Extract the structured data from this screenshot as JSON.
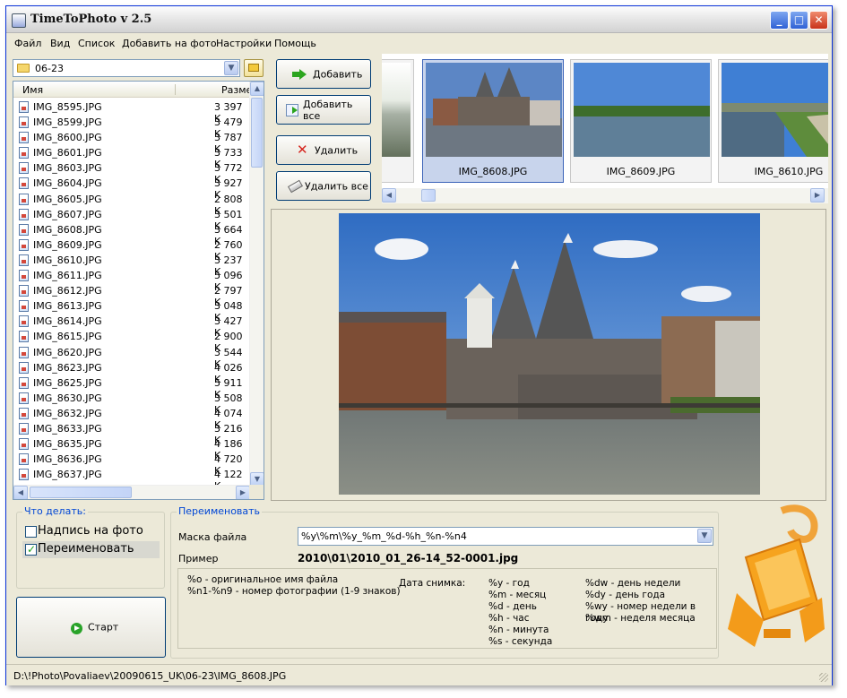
{
  "window": {
    "title": "TimeToPhoto v 2.5"
  },
  "menu": [
    "Файл",
    "Вид",
    "Список",
    "Добавить на фото",
    "Настройки",
    "Помощь"
  ],
  "folder": {
    "current": "06-23"
  },
  "file_list": {
    "columns": [
      "Имя",
      "Разме"
    ],
    "rows": [
      [
        "IMG_8595.JPG",
        "3 397 K"
      ],
      [
        "IMG_8599.JPG",
        "3 479 K"
      ],
      [
        "IMG_8600.JPG",
        "3 787 K"
      ],
      [
        "IMG_8601.JPG",
        "3 733 K"
      ],
      [
        "IMG_8603.JPG",
        "3 772 K"
      ],
      [
        "IMG_8604.JPG",
        "3 927 K"
      ],
      [
        "IMG_8605.JPG",
        "2 808 K"
      ],
      [
        "IMG_8607.JPG",
        "3 501 K"
      ],
      [
        "IMG_8608.JPG",
        "3 664 K"
      ],
      [
        "IMG_8609.JPG",
        "2 760 K"
      ],
      [
        "IMG_8610.JPG",
        "3 237 K"
      ],
      [
        "IMG_8611.JPG",
        "5 096 K"
      ],
      [
        "IMG_8612.JPG",
        "2 797 K"
      ],
      [
        "IMG_8613.JPG",
        "3 048 K"
      ],
      [
        "IMG_8614.JPG",
        "3 427 K"
      ],
      [
        "IMG_8615.JPG",
        "2 900 K"
      ],
      [
        "IMG_8620.JPG",
        "3 544 K"
      ],
      [
        "IMG_8623.JPG",
        "4 026 K"
      ],
      [
        "IMG_8625.JPG",
        "5 911 K"
      ],
      [
        "IMG_8630.JPG",
        "3 508 K"
      ],
      [
        "IMG_8632.JPG",
        "4 074 K"
      ],
      [
        "IMG_8633.JPG",
        "3 216 K"
      ],
      [
        "IMG_8635.JPG",
        "4 186 K"
      ],
      [
        "IMG_8636.JPG",
        "4 720 K"
      ],
      [
        "IMG_8637.JPG",
        "4 122 K"
      ]
    ]
  },
  "buttons": {
    "add": "Добавить",
    "add_all": "Добавить все",
    "delete": "Удалить",
    "delete_all": "Удалить все",
    "start": "Старт"
  },
  "thumbnails": [
    {
      "label": "IMG_8608.JPG",
      "selected": true
    },
    {
      "label": "IMG_8609.JPG",
      "selected": false
    },
    {
      "label": "IMG_8610.JPG",
      "selected": false
    }
  ],
  "todo": {
    "legend": "Что делать:",
    "caption": {
      "label": "Надпись на фото",
      "checked": false
    },
    "rename": {
      "label": "Переименовать",
      "checked": true
    }
  },
  "rename": {
    "legend": "Переименовать",
    "mask_label": "Маска файла",
    "mask_value": "%y\\%m\\%y_%m_%d-%h_%n-%n4",
    "example_label": "Пример",
    "example_value": "2010\\01\\2010_01_26-14_52-0001.jpg",
    "legend_left": [
      "%o - оригинальное имя файла",
      "%n1-%n9 - номер фотографии (1-9 знаков)"
    ],
    "date_label": "Дата снимка:",
    "legend_mid": [
      "%y - год",
      "%m - месяц",
      "%d - день",
      "%h - час",
      "%n - минута",
      "%s - секунда"
    ],
    "legend_right": [
      "%dw - день недели",
      "%dy - день года",
      "%wy - номер недели в году",
      "%wm - неделя месяца"
    ]
  },
  "status": {
    "path": "D:\\!Photo\\Povaliaev\\20090615_UK\\06-23\\IMG_8608.JPG"
  },
  "colors": {
    "accent": "#0046d5",
    "window_bg": "#ece9d8",
    "selection": "#c8d4ec"
  }
}
